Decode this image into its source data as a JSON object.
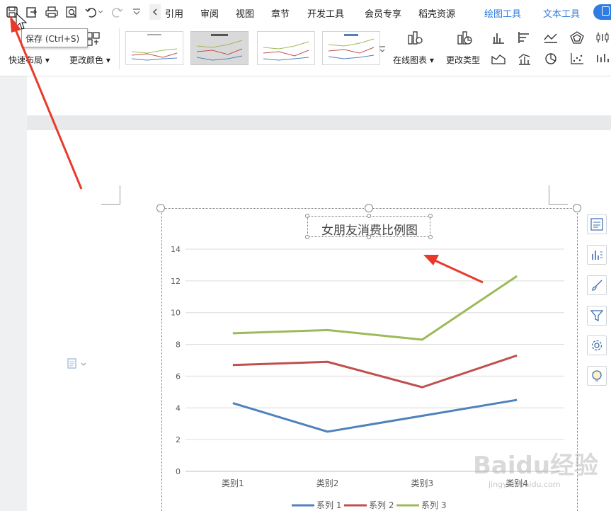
{
  "menubar": {
    "tabs": [
      {
        "label": "引用"
      },
      {
        "label": "审阅"
      },
      {
        "label": "视图"
      },
      {
        "label": "章节"
      },
      {
        "label": "开发工具"
      },
      {
        "label": "会员专享"
      },
      {
        "label": "稻壳资源"
      }
    ],
    "context_tabs": [
      {
        "label": "绘图工具"
      },
      {
        "label": "文本工具"
      }
    ],
    "accent_color": "#2f7de1"
  },
  "ribbon": {
    "quick_layout_label": "快速布局",
    "change_color_label": "更改颜色",
    "online_chart_label": "在线图表",
    "change_type_label": "更改类型"
  },
  "tooltip": {
    "text": "保存 (Ctrl+S)"
  },
  "chart_data": {
    "type": "line",
    "title": "女朋友消费比例图",
    "categories": [
      "类别1",
      "类别2",
      "类别3",
      "类别4"
    ],
    "ylim": [
      0,
      14
    ],
    "yticks": [
      0,
      2,
      4,
      6,
      8,
      10,
      12,
      14
    ],
    "grid": true,
    "legend_position": "bottom",
    "series": [
      {
        "name": "系列 1",
        "color": "#4f81bd",
        "values": [
          4.3,
          2.5,
          3.5,
          4.5
        ]
      },
      {
        "name": "系列 2",
        "color": "#c0504d",
        "values": [
          6.7,
          6.9,
          5.3,
          7.3
        ]
      },
      {
        "name": "系列 3",
        "color": "#9bbb59",
        "values": [
          8.7,
          8.9,
          8.3,
          12.3
        ]
      }
    ]
  },
  "watermark": {
    "brand": "Baidu经验",
    "url": "jingyan.baidu.com"
  },
  "icons": {
    "quick_access": [
      "save-icon",
      "export-icon",
      "print-icon",
      "print-preview-icon",
      "undo-icon",
      "redo-icon",
      "customize-icon"
    ],
    "side_toolbar": [
      "chart-elements-icon",
      "chart-style-icon",
      "brush-icon",
      "filter-icon",
      "settings-icon",
      "idea-icon"
    ]
  }
}
